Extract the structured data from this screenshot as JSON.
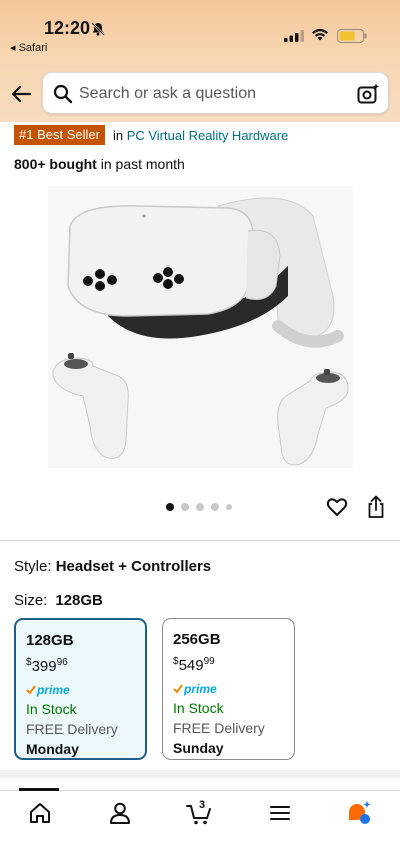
{
  "status_bar": {
    "time": "12:20",
    "back_app": "◂ Safari"
  },
  "search": {
    "placeholder": "Search or ask a question"
  },
  "product": {
    "best_seller_badge": "#1 Best Seller",
    "category_prefix": "in",
    "category": "PC Virtual Reality Hardware",
    "bought_count": "800+ bought",
    "bought_suffix": "in past month"
  },
  "gallery": {
    "image_count": 5,
    "active_index": 0
  },
  "style": {
    "label": "Style:",
    "value": "Headset + Controllers"
  },
  "size": {
    "label": "Size:",
    "value": "128GB",
    "options": [
      {
        "name": "128GB",
        "currency": "$",
        "dollars": "399",
        "cents": "96",
        "prime": "prime",
        "stock": "In Stock",
        "delivery": "FREE Delivery",
        "day": "Monday",
        "selected": true
      },
      {
        "name": "256GB",
        "currency": "$",
        "dollars": "549",
        "cents": "99",
        "prime": "prime",
        "stock": "In Stock",
        "delivery": "FREE Delivery",
        "day": "Sunday",
        "selected": false
      }
    ]
  },
  "tabbar": {
    "cart_count": "3",
    "tabs": [
      "home-icon",
      "account-icon",
      "cart-icon",
      "menu-icon",
      "rufus-chat-icon"
    ]
  },
  "colors": {
    "best_seller": "#c45500",
    "link": "#007185",
    "in_stock": "#007600",
    "prime_blue": "#00a8e1",
    "selected_border": "#1f5e8a",
    "header_gradient_top": "#f5c79a"
  }
}
